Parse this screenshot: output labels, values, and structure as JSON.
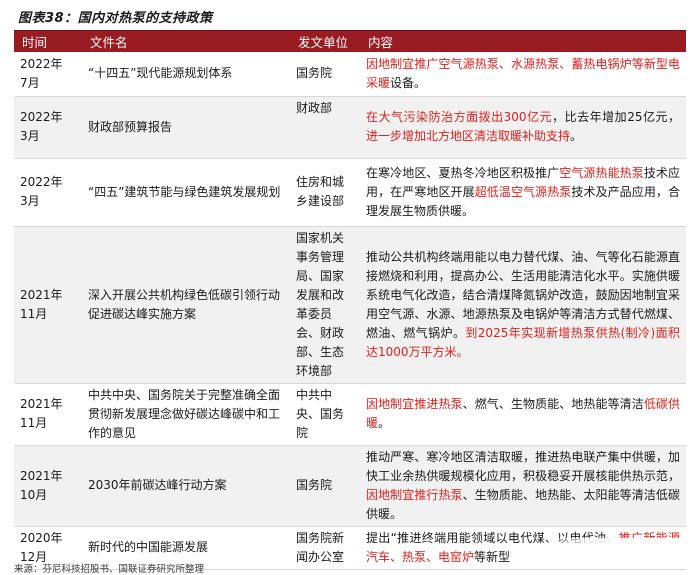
{
  "title": "图表38：国内对热泵的支持政策",
  "table": {
    "headers": [
      "时间",
      "文件名",
      "发文单位",
      "内容"
    ],
    "rows": [
      {
        "time": "2022年\n7月",
        "name": "“十四五”现代能源规划体系",
        "unit": "国务院",
        "content": [
          {
            "t": "因地制宜推广空气源热泵、水源热泵、蓄热电锅炉等新型电采暖",
            "red": true
          },
          {
            "t": "设备。",
            "red": false
          }
        ]
      },
      {
        "time": "2022年\n3月",
        "name": "财政部预算报告",
        "unit": "财政部",
        "unit_align": "top",
        "content": [
          {
            "t": "在大气污染防治方面拨出300亿元",
            "red": true
          },
          {
            "t": "，比去年增加25亿元，",
            "red": false
          },
          {
            "t": "进一步增加北方地区清洁取暖补助支持",
            "red": true
          },
          {
            "t": "。",
            "red": false
          }
        ]
      },
      {
        "time": "2022年\n3月",
        "name": "“四五”建筑节能与绿色建筑发展规划",
        "unit": "住房和城乡建设部",
        "content": [
          {
            "t": "在寒冷地区、夏热冬冷地区积极推广",
            "red": false
          },
          {
            "t": "空气源热能热泵",
            "red": true
          },
          {
            "t": "技术应用，在严寒地区开展",
            "red": false
          },
          {
            "t": "超低温空气源热泵",
            "red": true
          },
          {
            "t": "技术及产品应用，合理发展生物质供暖。",
            "red": false
          }
        ]
      },
      {
        "time": "2021年\n11月",
        "name": "深入开展公共机构绿色低碳引领行动促进碳达峰实施方案",
        "unit": "国家机关事务管理局、国家发展和改革委员会、财政部、生态环境部",
        "content": [
          {
            "t": "推动公共机构终端用能以电力替代煤、油、气等化石能源直接燃烧和利用，提高办公、生活用能清洁化水平。实施供暖系统电气化改造，结合清煤降氮锅炉改造，鼓励因地制宜采用空气源、水源、地源热泵及电锅炉等清洁方式替代燃煤、燃油、燃气锅炉。",
            "red": false
          },
          {
            "t": "到2025年实现新增热泵供热(制冷)面积达1000万平方米。",
            "red": true
          }
        ]
      },
      {
        "time": "2021年\n11月",
        "name": "中共中央、国务院关于完整准确全面贯彻新发展理念做好碳达峰碳中和工作的意见",
        "unit": "中共中央、国务院",
        "content": [
          {
            "t": "因地制宜推进热泵",
            "red": true
          },
          {
            "t": "、燃气、生物质能、地热能等清洁",
            "red": false
          },
          {
            "t": "低碳供暖",
            "red": true
          },
          {
            "t": "。",
            "red": false
          }
        ]
      },
      {
        "time": "2021年\n10月",
        "name": "2030年前碳达峰行动方案",
        "unit": "国务院",
        "content": [
          {
            "t": "推动严寒、寒冷地区清洁取暖，推进热电联产集中供暖，加快工业余热供暖规模化应用，积极稳妥开展核能供热示范，",
            "red": false
          },
          {
            "t": "因地制宜推行热泵",
            "red": true
          },
          {
            "t": "、生物质能、地热能、太阳能等清洁低碳供暖。",
            "red": false
          }
        ]
      },
      {
        "time": "2020年\n12月",
        "name": "新时代的中国能源发展",
        "unit": "国务院新闻办公室",
        "content": [
          {
            "t": "提出“推进终端用能领域以电代煤、以电代油，",
            "red": false
          },
          {
            "t": "推广新能源汽车、热泵、电窑炉",
            "red": true
          },
          {
            "t": "等新型",
            "red": false
          }
        ]
      }
    ]
  },
  "source": "来源：芬尼科技招股书、国联证券研究所整理",
  "colors": {
    "header_bg": "#991c22",
    "highlight": "#e0201d",
    "stripe": "#f1f1f1"
  }
}
